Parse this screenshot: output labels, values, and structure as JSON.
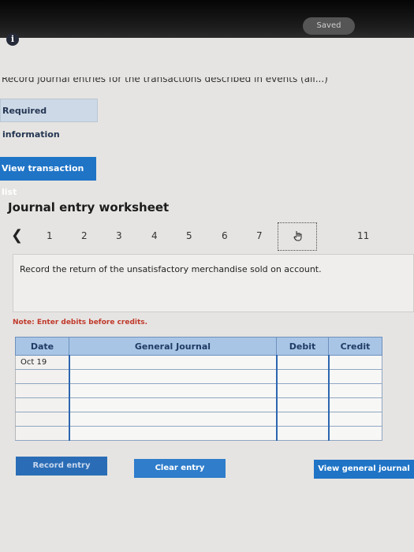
{
  "status": {
    "saved_label": "Saved"
  },
  "info_icon": {
    "glyph": "i"
  },
  "cutoff_text": "Record journal entries for the transactions described in events (all...)",
  "required_info": {
    "label": "Required information"
  },
  "view_transactions": {
    "label": "View transaction list"
  },
  "worksheet": {
    "title": "Journal entry worksheet",
    "pages": [
      "1",
      "2",
      "3",
      "4",
      "5",
      "6",
      "7",
      "11"
    ],
    "instruction": "Record the return of the unsatisfactory merchandise sold on account.",
    "note": "Note: Enter debits before credits."
  },
  "journal_table": {
    "headers": {
      "date": "Date",
      "general_journal": "General Journal",
      "debit": "Debit",
      "credit": "Credit"
    },
    "date_value": "Oct 19"
  },
  "buttons": {
    "record_entry": "Record entry",
    "clear_entry": "Clear entry",
    "view_general_journal": "View general journal"
  },
  "colors": {
    "accent": "#1f74c6",
    "note_red": "#c0392b",
    "header_blue": "#a9c5e6"
  }
}
